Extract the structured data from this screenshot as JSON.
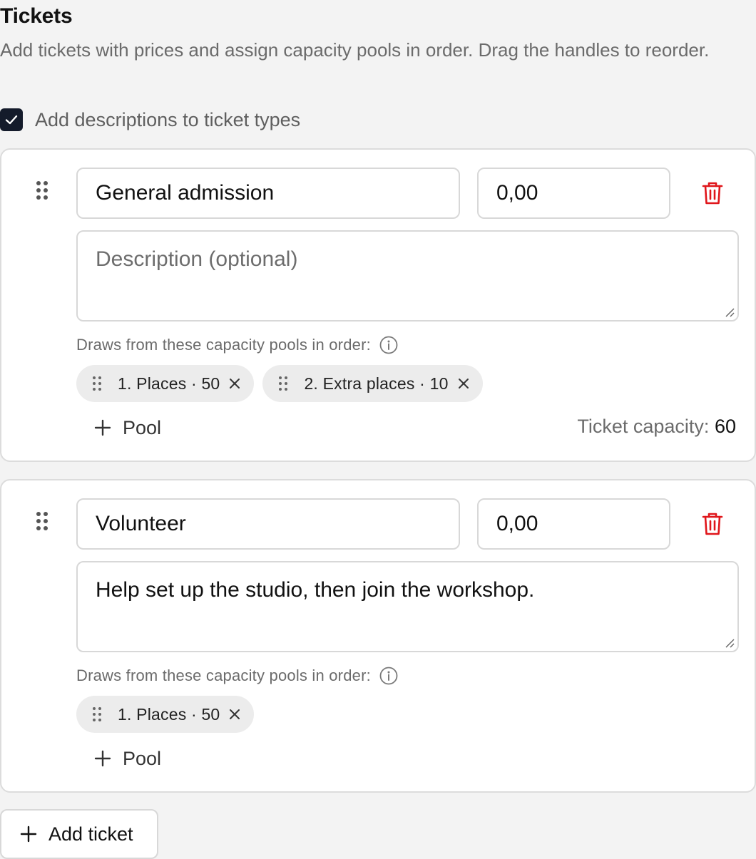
{
  "section": {
    "title": "Tickets",
    "description": "Add tickets with prices and assign capacity pools in order. Drag the handles to reorder.",
    "descriptions_toggle": {
      "label": "Add descriptions to ticket types",
      "checked": true
    }
  },
  "tickets": [
    {
      "name": "General admission",
      "price": "0,00",
      "description_value": "",
      "description_placeholder": "Description (optional)",
      "pools_label": "Draws from these capacity pools in order:",
      "pools": [
        {
          "label": "1. Places · 50"
        },
        {
          "label": "2. Extra places · 10"
        }
      ],
      "add_pool_label": "Pool",
      "capacity_label": "Ticket capacity:",
      "capacity_value": "60"
    },
    {
      "name": "Volunteer",
      "price": "0,00",
      "description_value": "Help set up the studio, then join the workshop.",
      "description_placeholder": "Description (optional)",
      "pools_label": "Draws from these capacity pools in order:",
      "pools": [
        {
          "label": "1. Places · 50"
        }
      ],
      "add_pool_label": "Pool"
    }
  ],
  "add_ticket_label": "Add ticket",
  "colors": {
    "delete": "#e0161b",
    "checkbox": "#141b2b",
    "muted_text": "#6b6b6b"
  },
  "icons": [
    "check-icon",
    "drag-handle-icon",
    "trash-icon",
    "info-icon",
    "close-icon",
    "plus-icon"
  ]
}
